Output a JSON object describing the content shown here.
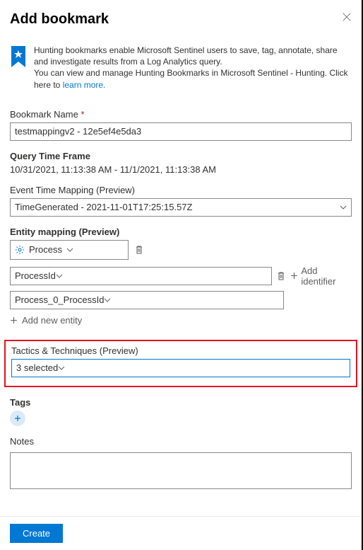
{
  "header": {
    "title": "Add bookmark"
  },
  "info": {
    "line1": "Hunting bookmarks enable Microsoft Sentinel users to save, tag, annotate, share and investigate results from a Log Analytics query.",
    "line2a": "You can view and manage Hunting Bookmarks in Microsoft Sentinel - Hunting. Click here to ",
    "learn_more": "learn more."
  },
  "bookmark_name": {
    "label": "Bookmark Name",
    "value": "testmappingv2 - 12e5ef4e5da3"
  },
  "query_time": {
    "label": "Query Time Frame",
    "value": "10/31/2021, 11:13:38 AM - 11/1/2021, 11:13:38 AM"
  },
  "event_time": {
    "label": "Event Time Mapping (Preview)",
    "value": "TimeGenerated - 2021-11-01T17:25:15.57Z"
  },
  "entity_mapping": {
    "label": "Entity mapping (Preview)",
    "type_value": "Process",
    "identifier1": "ProcessId",
    "identifier2": "Process_0_ProcessId",
    "add_identifier": "Add identifier",
    "add_entity": "Add new entity"
  },
  "tactics": {
    "label": "Tactics & Techniques (Preview)",
    "value": "3 selected"
  },
  "tags": {
    "label": "Tags"
  },
  "notes": {
    "label": "Notes"
  },
  "footer": {
    "create": "Create"
  }
}
